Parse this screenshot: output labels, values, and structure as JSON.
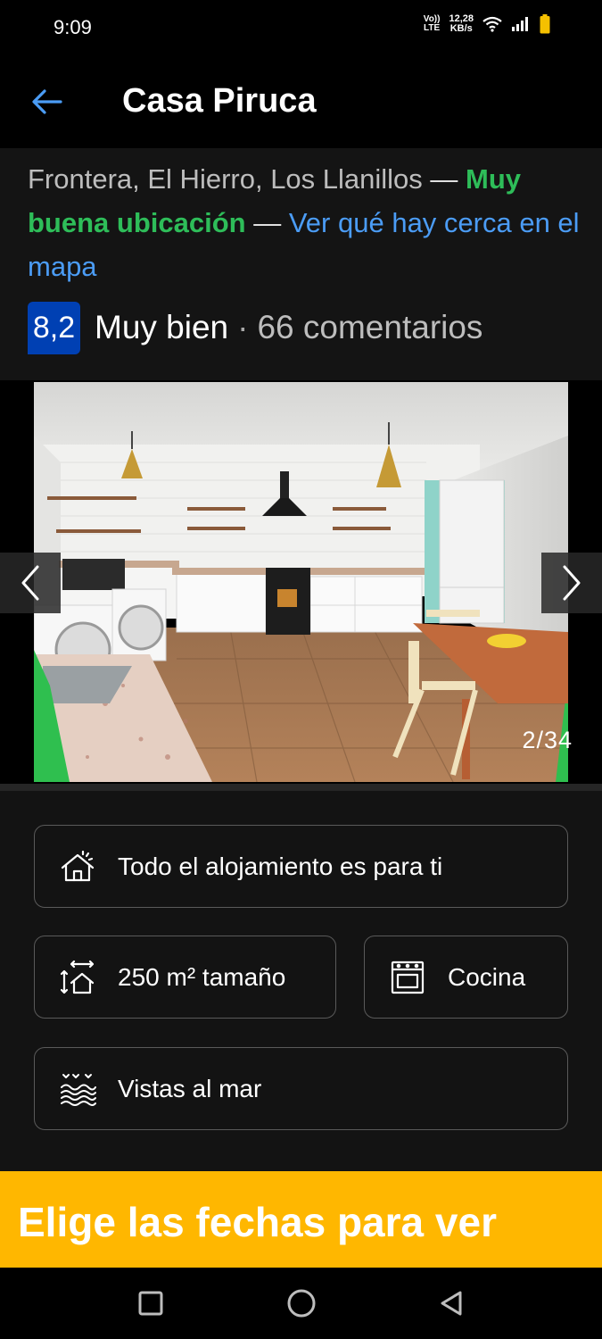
{
  "status_bar": {
    "time": "9:09",
    "network_top": "Vo))",
    "network_bottom": "LTE",
    "speed_value": "12,28",
    "speed_unit": "KB/s"
  },
  "app_bar": {
    "title": "Casa Piruca",
    "back_icon": "arrow-left-icon"
  },
  "header": {
    "location": "Frontera, El Hierro, Los Llanillos",
    "dash_1": " — ",
    "location_quality": "Muy buena ubicación",
    "dash_2": " — ",
    "map_link": "Ver qué hay cerca en el mapa",
    "rating_score": "8,2",
    "rating_label": "Muy bien",
    "separator": "·",
    "review_count": "66 comentarios"
  },
  "gallery": {
    "counter": "2/34",
    "prev_icon": "chevron-left-icon",
    "next_icon": "chevron-right-icon"
  },
  "features": [
    {
      "label": "Todo el alojamiento es para ti",
      "icon": "house-icon"
    },
    {
      "label": "250 m² tamaño",
      "icon": "size-icon"
    },
    {
      "label": "Cocina",
      "icon": "oven-icon"
    },
    {
      "label": "Vistas al mar",
      "icon": "sea-view-icon"
    }
  ],
  "cta": {
    "text": "Elige las fechas para ver"
  },
  "colors": {
    "accent_green": "#2ebd59",
    "link_blue": "#4b9cf5",
    "score_badge": "#0040b3",
    "cta_yellow": "#ffb700"
  }
}
